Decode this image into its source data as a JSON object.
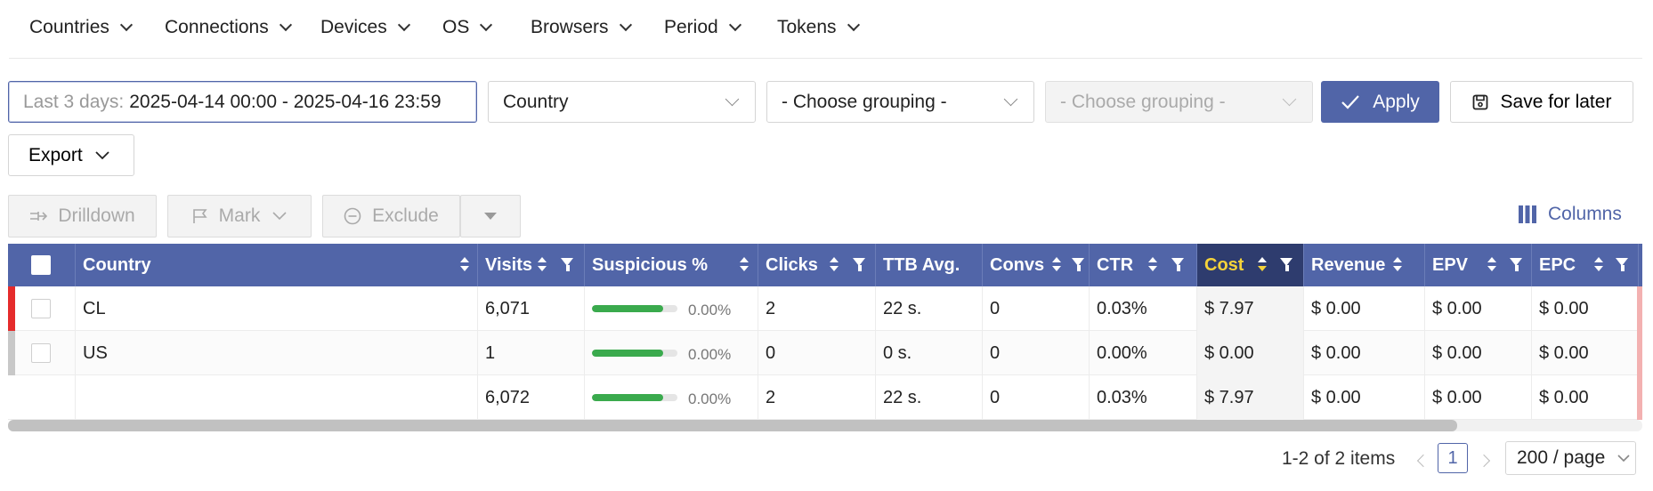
{
  "topnav": [
    {
      "label": "Countries"
    },
    {
      "label": "Connections"
    },
    {
      "label": "Devices"
    },
    {
      "label": "OS"
    },
    {
      "label": "Browsers"
    },
    {
      "label": "Period"
    },
    {
      "label": "Tokens"
    }
  ],
  "filters": {
    "date_prefix": "Last 3 days:",
    "date_value": "2025-04-14 00:00 - 2025-04-16 23:59",
    "grouping1": "Country",
    "grouping2": "- Choose grouping -",
    "grouping3": "- Choose grouping -",
    "apply_label": "Apply",
    "save_label": "Save for later",
    "export_label": "Export"
  },
  "actions": {
    "drilldown": "Drilldown",
    "mark": "Mark",
    "exclude": "Exclude",
    "columns": "Columns"
  },
  "table": {
    "headers": [
      "Country",
      "Visits",
      "Suspicious %",
      "Clicks",
      "TTB Avg.",
      "Convs",
      "CTR",
      "Cost",
      "Revenue",
      "EPV",
      "EPC"
    ],
    "rows": [
      {
        "country": "CL",
        "visits": "6,071",
        "suspicious": "0.00%",
        "clicks": "2",
        "ttb": "22 s.",
        "convs": "0",
        "ctr": "0.03%",
        "cost": "$ 7.97",
        "revenue": "$ 0.00",
        "epv": "$ 0.00",
        "epc": "$ 0.00",
        "mark_color": "#e52b2b"
      },
      {
        "country": "US",
        "visits": "1",
        "suspicious": "0.00%",
        "clicks": "0",
        "ttb": "0 s.",
        "convs": "0",
        "ctr": "0.00%",
        "cost": "$ 0.00",
        "revenue": "$ 0.00",
        "epv": "$ 0.00",
        "epc": "$ 0.00",
        "mark_color": "#c8c8c8"
      }
    ],
    "totals": {
      "visits": "6,072",
      "suspicious": "0.00%",
      "clicks": "2",
      "ttb": "22 s.",
      "convs": "0",
      "ctr": "0.03%",
      "cost": "$ 7.97",
      "revenue": "$ 0.00",
      "epv": "$ 0.00",
      "epc": "$ 0.00"
    },
    "suspicious_fill": 0.83
  },
  "pagination": {
    "total": "1-2 of 2 items",
    "page": "1",
    "page_size": "200 / page"
  },
  "colors": {
    "accent": "#5165a8",
    "active_header": "#2e3c6e",
    "highlight": "#f5d33a",
    "progress": "#3aaa4d"
  }
}
